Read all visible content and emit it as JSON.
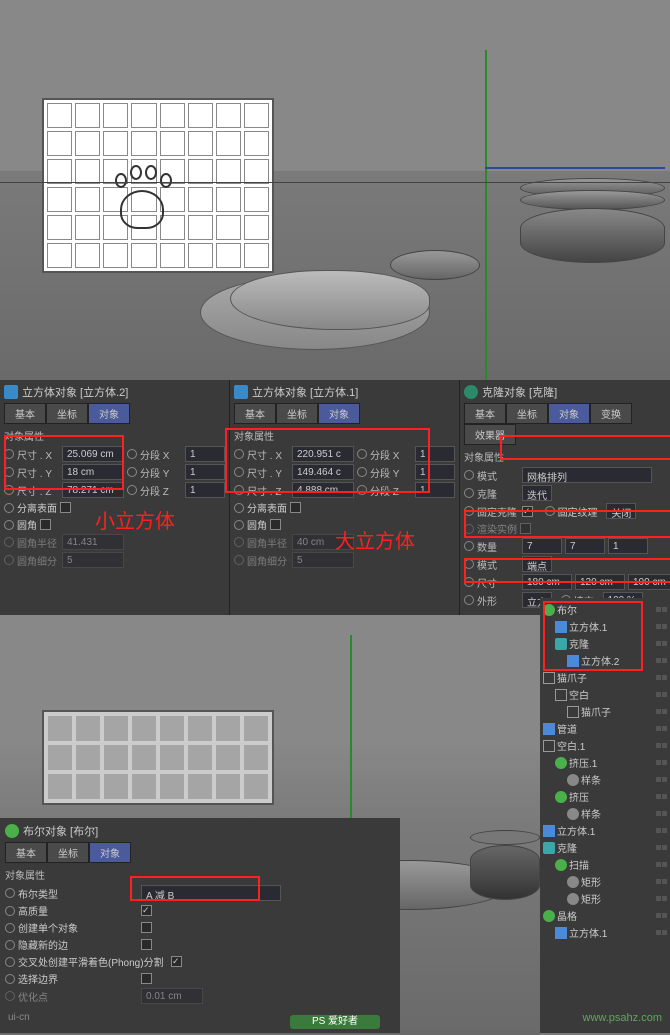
{
  "panel1": {
    "title": "立方体对象 [立方体.2]",
    "tabs": {
      "basic": "基本",
      "coord": "坐标",
      "object": "对象"
    },
    "section": "对象属性",
    "sizeX": {
      "label": "尺寸 . X",
      "value": "25.069 cm"
    },
    "sizeY": {
      "label": "尺寸 . Y",
      "value": "18 cm"
    },
    "sizeZ": {
      "label": "尺寸 . Z",
      "value": "78.271 cm"
    },
    "segX": {
      "label": "分段 X",
      "value": "1"
    },
    "segY": {
      "label": "分段 Y",
      "value": "1"
    },
    "segZ": {
      "label": "分段 Z",
      "value": "1"
    },
    "separate": "分离表面",
    "fillet": "圆角",
    "filletR": {
      "label": "圆角半径",
      "value": "41.431"
    },
    "filletSub": {
      "label": "圆角细分",
      "value": "5"
    },
    "annotation": "小立方体"
  },
  "panel2": {
    "title": "立方体对象 [立方体.1]",
    "tabs": {
      "basic": "基本",
      "coord": "坐标",
      "object": "对象"
    },
    "section": "对象属性",
    "sizeX": {
      "label": "尺寸 . X",
      "value": "220.951 c"
    },
    "sizeY": {
      "label": "尺寸 . Y",
      "value": "149.464 c"
    },
    "sizeZ": {
      "label": "尺寸 . Z",
      "value": "4.888 cm"
    },
    "segX": {
      "label": "分段 X",
      "value": "1"
    },
    "segY": {
      "label": "分段 Y",
      "value": "1"
    },
    "segZ": {
      "label": "分段 Z",
      "value": "1"
    },
    "separate": "分离表面",
    "fillet": "圆角",
    "filletR": {
      "label": "圆角半径",
      "value": "40 cm"
    },
    "filletSub": {
      "label": "圆角细分",
      "value": "5"
    },
    "annotation": "大立方体"
  },
  "panel3": {
    "title": "克隆对象 [克隆]",
    "tabs": {
      "basic": "基本",
      "coord": "坐标",
      "object": "对象",
      "transform": "变换",
      "effector": "效果器"
    },
    "section": "对象属性",
    "mode": {
      "label": "模式",
      "value": "网格排列"
    },
    "clone": {
      "label": "克隆",
      "value": "迭代"
    },
    "fixClone": "固定克隆",
    "fixTex": {
      "label": "固定纹理",
      "value": "关闭"
    },
    "renderInst": "渲染实例",
    "count": {
      "label": "数量",
      "x": "7",
      "y": "7",
      "z": "1"
    },
    "mode2": {
      "label": "模式",
      "value": "端点"
    },
    "size": {
      "label": "尺寸",
      "x": "180 cm",
      "y": "120 cm",
      "z": "100 cm"
    },
    "shape": {
      "label": "外形",
      "value": "立方"
    },
    "fill": {
      "label": "填充",
      "value": "100 %"
    }
  },
  "boolPanel": {
    "title": "布尔对象 [布尔]",
    "tabs": {
      "basic": "基本",
      "coord": "坐标",
      "object": "对象"
    },
    "section": "对象属性",
    "boolType": {
      "label": "布尔类型",
      "value": "A 减 B"
    },
    "highQuality": "高质量",
    "createSingle": "创建单个对象",
    "hideNew": "隐藏新的边",
    "phong": "交叉处创建平滑着色(Phong)分割",
    "selBound": "选择边界",
    "optimize": {
      "label": "优化点",
      "value": "0.01 cm"
    }
  },
  "tree": {
    "items": [
      {
        "name": "布尔",
        "icon": "ic-green",
        "indent": 0
      },
      {
        "name": "立方体.1",
        "icon": "ic-blue",
        "indent": 1
      },
      {
        "name": "克隆",
        "icon": "ic-teal",
        "indent": 1
      },
      {
        "name": "立方体.2",
        "icon": "ic-blue",
        "indent": 2
      },
      {
        "name": "猫爪子",
        "icon": "ic-null",
        "indent": 0
      },
      {
        "name": "空白",
        "icon": "ic-null",
        "indent": 1
      },
      {
        "name": "猫爪子",
        "icon": "ic-null",
        "indent": 2
      },
      {
        "name": "管道",
        "icon": "ic-blue",
        "indent": 0
      },
      {
        "name": "空白.1",
        "icon": "ic-null",
        "indent": 0
      },
      {
        "name": "挤压.1",
        "icon": "ic-green",
        "indent": 1
      },
      {
        "name": "样条",
        "icon": "ic-spl",
        "indent": 2
      },
      {
        "name": "挤压",
        "icon": "ic-green",
        "indent": 1
      },
      {
        "name": "样条",
        "icon": "ic-spl",
        "indent": 2
      },
      {
        "name": "立方体.1",
        "icon": "ic-blue",
        "indent": 0
      },
      {
        "name": "克隆",
        "icon": "ic-teal",
        "indent": 0
      },
      {
        "name": "扫描",
        "icon": "ic-green",
        "indent": 1
      },
      {
        "name": "矩形",
        "icon": "ic-spl",
        "indent": 2
      },
      {
        "name": "矩形",
        "icon": "ic-spl",
        "indent": 2
      },
      {
        "name": "晶格",
        "icon": "ic-green",
        "indent": 0
      },
      {
        "name": "立方体.1",
        "icon": "ic-blue",
        "indent": 1
      }
    ]
  },
  "watermark": "www.psahz.com",
  "watermark2": "ui-cn"
}
